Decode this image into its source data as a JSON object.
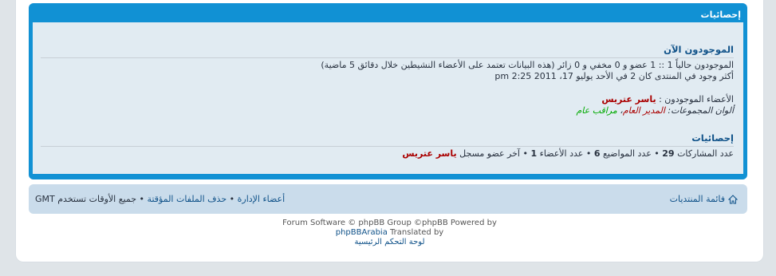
{
  "stats_panel": {
    "header": "إحصائيات",
    "who_is_online": {
      "title": "الموجودون الآن",
      "line1": "الموجودون حالياً 1 :: 1 عضو و 0 مخفي و 0 زائر (هذه البيانات تعتمد على الأعضاء النشيطين خلال دقائق 5 ماضية)",
      "line2": "أكثر وجود في المنتدى كان 2 في الأحد يوليو 17، 2011 pm 2:25",
      "members_label": "الأعضاء الموجودون :",
      "members_user": "ياسر عتريس",
      "legend_label": "ألوان المجموعات:",
      "legend_admin": "المدير العام",
      "legend_sep": "،",
      "legend_mod": "مراقب عام"
    },
    "statistics": {
      "title": "إحصائيات",
      "posts_label": "عدد المشاركات",
      "posts_value": "29",
      "topics_label": "عدد المواضيع",
      "topics_value": "6",
      "members_label": "عدد الأعضاء",
      "members_value": "1",
      "newest_label": "آخر عضو مسجل",
      "newest_user": "ياسر عتريس"
    }
  },
  "navbar": {
    "home_link": "فائمة المنتديات",
    "team_link": "أعضاء الإدارة",
    "delete_cookies_link": "حذف الملفات المؤقتة",
    "timezone_text": "جميع الأوقات تستخدم GMT"
  },
  "footer": {
    "line1": "Forum Software © phpBB Group ©phpBB Powered by",
    "line2_link": "phpBBArabia",
    "line2_text": "Translated by",
    "line3_link": "لوحة التحكم الرئيسية"
  },
  "colors": {
    "panel_blue": "#1191d4",
    "inner_bg": "#e1ebf2",
    "nav_bg": "#cadceb",
    "link": "#105289",
    "admin_red": "#aa0000",
    "mod_green": "#00aa00"
  }
}
